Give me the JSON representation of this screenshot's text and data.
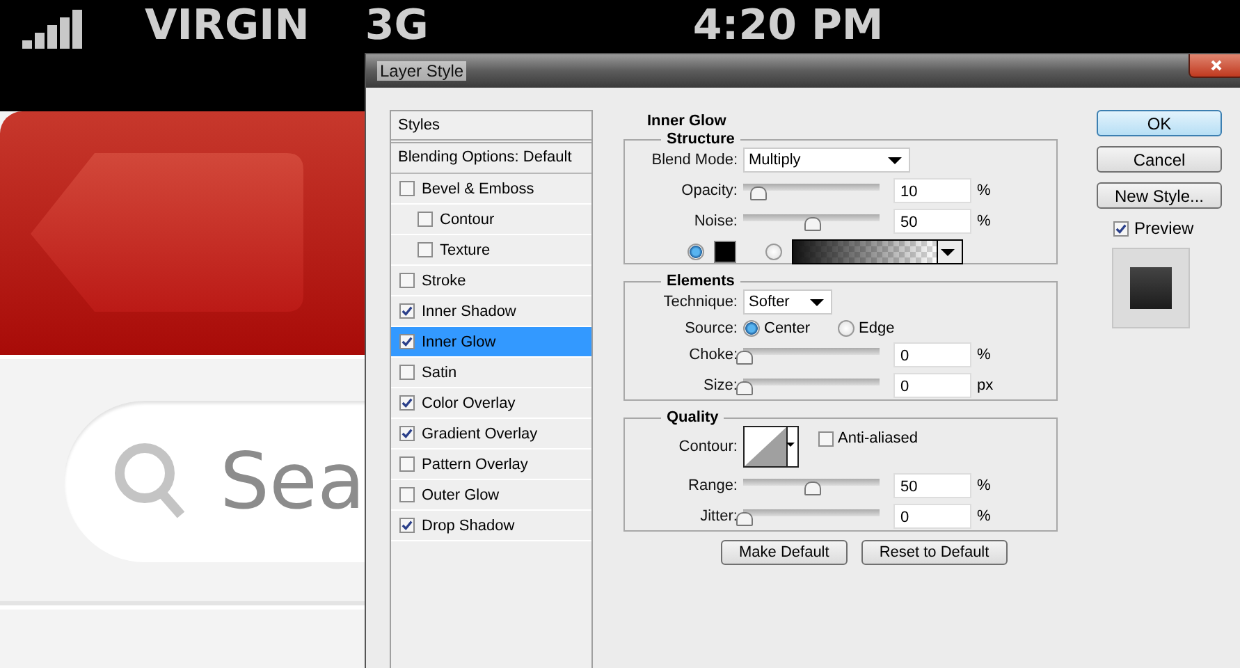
{
  "phone": {
    "carrier": "VIRGIN",
    "network": "3G",
    "time": "4:20 PM",
    "search": {
      "placeholder": "Sea"
    }
  },
  "dialog": {
    "title": "Layer Style",
    "styles_header": "Styles",
    "style_items": [
      {
        "kind": "option",
        "label": "Blending Options: Default",
        "selected": false
      },
      {
        "kind": "check",
        "label": "Bevel & Emboss",
        "checked": false,
        "selected": false,
        "children": [
          {
            "kind": "check",
            "label": "Contour",
            "checked": false,
            "selected": false
          },
          {
            "kind": "check",
            "label": "Texture",
            "checked": false,
            "selected": false
          }
        ]
      },
      {
        "kind": "check",
        "label": "Stroke",
        "checked": false,
        "selected": false
      },
      {
        "kind": "check",
        "label": "Inner Shadow",
        "checked": true,
        "selected": false
      },
      {
        "kind": "check",
        "label": "Inner Glow",
        "checked": true,
        "selected": true
      },
      {
        "kind": "check",
        "label": "Satin",
        "checked": false,
        "selected": false
      },
      {
        "kind": "check",
        "label": "Color Overlay",
        "checked": true,
        "selected": false
      },
      {
        "kind": "check",
        "label": "Gradient Overlay",
        "checked": true,
        "selected": false
      },
      {
        "kind": "check",
        "label": "Pattern Overlay",
        "checked": false,
        "selected": false
      },
      {
        "kind": "check",
        "label": "Outer Glow",
        "checked": false,
        "selected": false
      },
      {
        "kind": "check",
        "label": "Drop Shadow",
        "checked": true,
        "selected": false
      }
    ],
    "panel_title": "Inner Glow",
    "structure": {
      "title": "Structure",
      "blend_mode": {
        "label": "Blend Mode:",
        "value": "Multiply"
      },
      "sliders": [
        {
          "label": "Opacity:",
          "level": 0.1,
          "value": "10",
          "unit": "%"
        },
        {
          "label": "Noise:",
          "level": 0.5,
          "value": "50",
          "unit": "%"
        }
      ],
      "fill": [
        {
          "kind": "color",
          "selected": true
        },
        {
          "kind": "gradient",
          "selected": false
        }
      ]
    },
    "elements": {
      "title": "Elements",
      "technique": {
        "label": "Technique:",
        "value": "Softer"
      },
      "source": {
        "label": "Source:",
        "options": [
          {
            "label": "Center",
            "selected": true
          },
          {
            "label": "Edge",
            "selected": false
          }
        ]
      },
      "sliders": [
        {
          "label": "Choke:",
          "level": 0,
          "value": "0",
          "unit": "%"
        },
        {
          "label": "Size:",
          "level": 0,
          "value": "0",
          "unit": "px"
        }
      ]
    },
    "quality": {
      "title": "Quality",
      "contour_label": "Contour:",
      "anti_aliased": {
        "label": "Anti-aliased",
        "checked": false
      },
      "sliders": [
        {
          "label": "Range:",
          "level": 0.5,
          "value": "50",
          "unit": "%"
        },
        {
          "label": "Jitter:",
          "level": 0,
          "value": "0",
          "unit": "%"
        }
      ]
    },
    "bottom_buttons": [
      "Make Default",
      "Reset to Default"
    ],
    "side_buttons": [
      {
        "label": "OK",
        "default": true
      },
      {
        "label": "Cancel",
        "default": false
      },
      {
        "label": "New Style...",
        "default": false
      }
    ],
    "preview": {
      "label": "Preview",
      "checked": true
    }
  }
}
